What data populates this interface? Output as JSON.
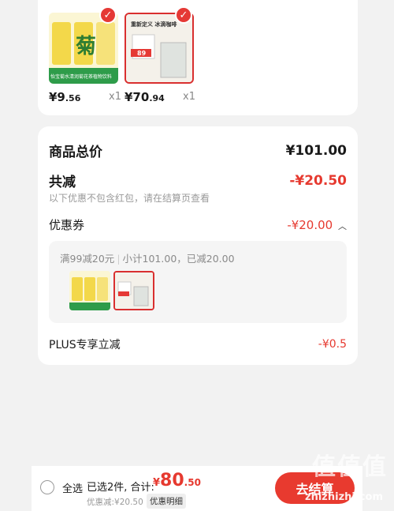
{
  "products": [
    {
      "price_main": "¥9",
      "price_dec": ".56",
      "qty": "x1",
      "image_text": "菊",
      "banner": "怡宝菊水清润菊花茶植物饮料"
    },
    {
      "price_main": "¥70",
      "price_dec": ".94",
      "qty": "x1",
      "image_text": "重新定义 冰滴咖啡",
      "tag": "89"
    }
  ],
  "summary": {
    "total_label": "商品总价",
    "total_value": "¥101.00",
    "discount_label": "共减",
    "discount_value": "-¥20.50",
    "discount_note": "以下优惠不包含红包，请在结算页查看",
    "coupon_label": "优惠券",
    "coupon_value": "-¥20.00",
    "coupon_rule": "满99减20元",
    "coupon_detail": "小计101.00，已减20.00",
    "plus_label": "PLUS专享立减",
    "plus_value": "-¥0.5"
  },
  "bottom": {
    "select_all": "全选",
    "selected": "已选2件, 合计:",
    "total_currency": "¥",
    "total_main": "80",
    "total_dec": ".50",
    "discount_small": "优惠减:¥20.50",
    "detail_chip": "优惠明细",
    "checkout": "去结算"
  },
  "watermark": {
    "text": "值值值",
    "url": "zhizhizhi.com"
  },
  "colors": {
    "accent": "#e6392f",
    "checkout": "#e83a2f"
  }
}
